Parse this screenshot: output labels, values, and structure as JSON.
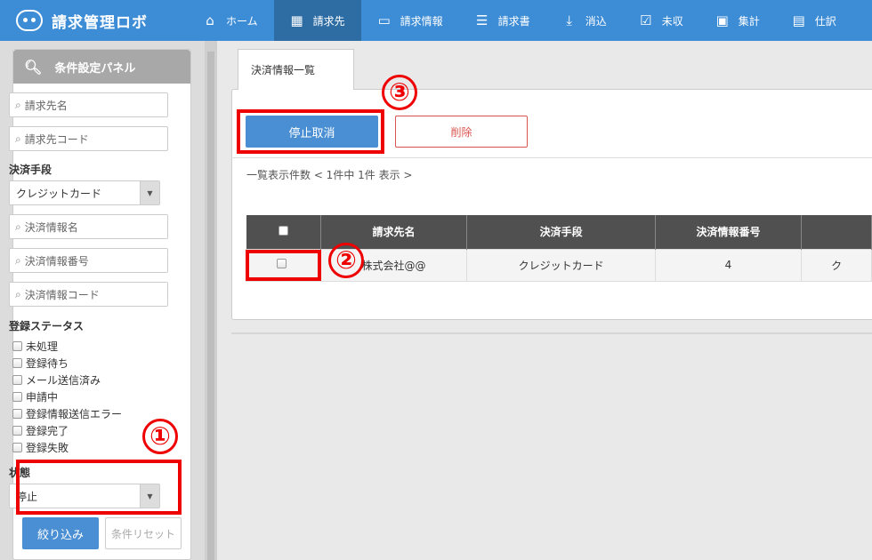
{
  "app": {
    "name": "請求管理ロボ"
  },
  "nav": {
    "items": [
      {
        "label": "ホーム",
        "icon": "home-icon",
        "glyph": "⌂"
      },
      {
        "label": "請求先",
        "icon": "building-icon",
        "glyph": "▦",
        "active": true
      },
      {
        "label": "請求情報",
        "icon": "inbox-icon",
        "glyph": "▭"
      },
      {
        "label": "請求書",
        "icon": "list-icon",
        "glyph": "☰"
      },
      {
        "label": "消込",
        "icon": "download-icon",
        "glyph": "⤓"
      },
      {
        "label": "未収",
        "icon": "check-icon",
        "glyph": "☑"
      },
      {
        "label": "集計",
        "icon": "calculator-icon",
        "glyph": "▣"
      },
      {
        "label": "仕訳",
        "icon": "table-icon",
        "glyph": "▤"
      }
    ]
  },
  "sidebar": {
    "title": "条件設定パネル",
    "fields": {
      "billing_name": "請求先名",
      "billing_code": "請求先コード",
      "payment_info_name": "決済情報名",
      "payment_info_number": "決済情報番号",
      "payment_info_code": "決済情報コード"
    },
    "payment_method_label": "決済手段",
    "payment_method_value": "クレジットカード",
    "status_label": "登録ステータス",
    "statuses": [
      "未処理",
      "登録待ち",
      "メール送信済み",
      "申請中",
      "登録情報送信エラー",
      "登録完了",
      "登録失敗"
    ],
    "state_label": "状態",
    "state_value": "停止",
    "filter_button": "絞り込み",
    "reset_button": "条件リセット"
  },
  "main": {
    "tab_label": "決済情報一覧",
    "cancel_stop_button": "停止取消",
    "delete_button": "削除",
    "count_text": "一覧表示件数 < 1件中 1件 表示 >",
    "table": {
      "headers": [
        "請求先名",
        "決済手段",
        "決済情報番号"
      ],
      "rows": [
        {
          "billing_name": "株式会社@@",
          "payment_method": "クレジットカード",
          "number": "4",
          "extra": "ク"
        }
      ]
    }
  },
  "annotations": {
    "step1": "①",
    "step2": "②",
    "step3": "③"
  },
  "colors": {
    "nav": "#3d8cd6",
    "nav_active": "#2e6da4",
    "primary": "#4a8fd4",
    "danger": "#d9534f",
    "annotation": "#e00000"
  }
}
